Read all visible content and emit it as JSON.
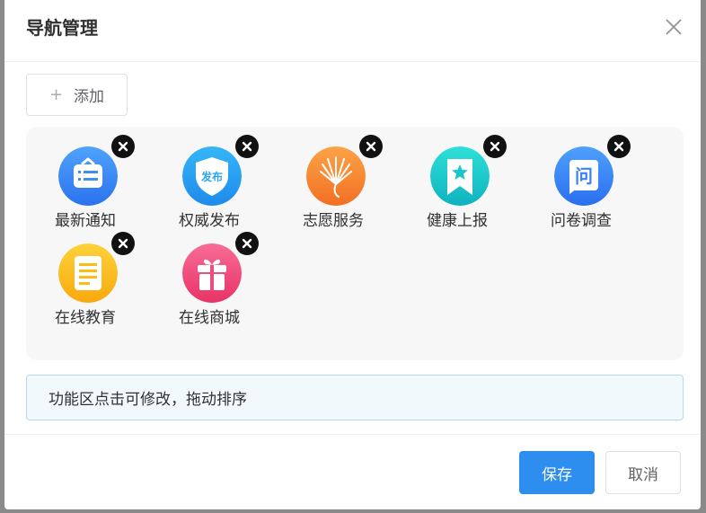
{
  "dialog": {
    "title": "导航管理",
    "add_label": "添加",
    "tip": "功能区点击可修改，拖动排序",
    "save_label": "保存",
    "cancel_label": "取消"
  },
  "items": [
    {
      "label": "最新通知",
      "icon": "notice-icon",
      "color": "#3d8ff5"
    },
    {
      "label": "权威发布",
      "icon": "shield-publish-icon",
      "color": "#2aa5f2"
    },
    {
      "label": "志愿服务",
      "icon": "peacock-icon",
      "color": "#f58a2e"
    },
    {
      "label": "健康上报",
      "icon": "star-bookmark-icon",
      "color": "#19c7c9"
    },
    {
      "label": "问卷调查",
      "icon": "question-doc-icon",
      "color": "#3a82f6"
    },
    {
      "label": "在线教育",
      "icon": "notebook-icon",
      "color": "#fbbc14"
    },
    {
      "label": "在线商城",
      "icon": "gift-icon",
      "color": "#ef4b7d"
    }
  ],
  "colors": {
    "primary": "#2e8ef0",
    "tip_bg": "#f2f9fd",
    "tip_border": "#b3dcf0"
  }
}
